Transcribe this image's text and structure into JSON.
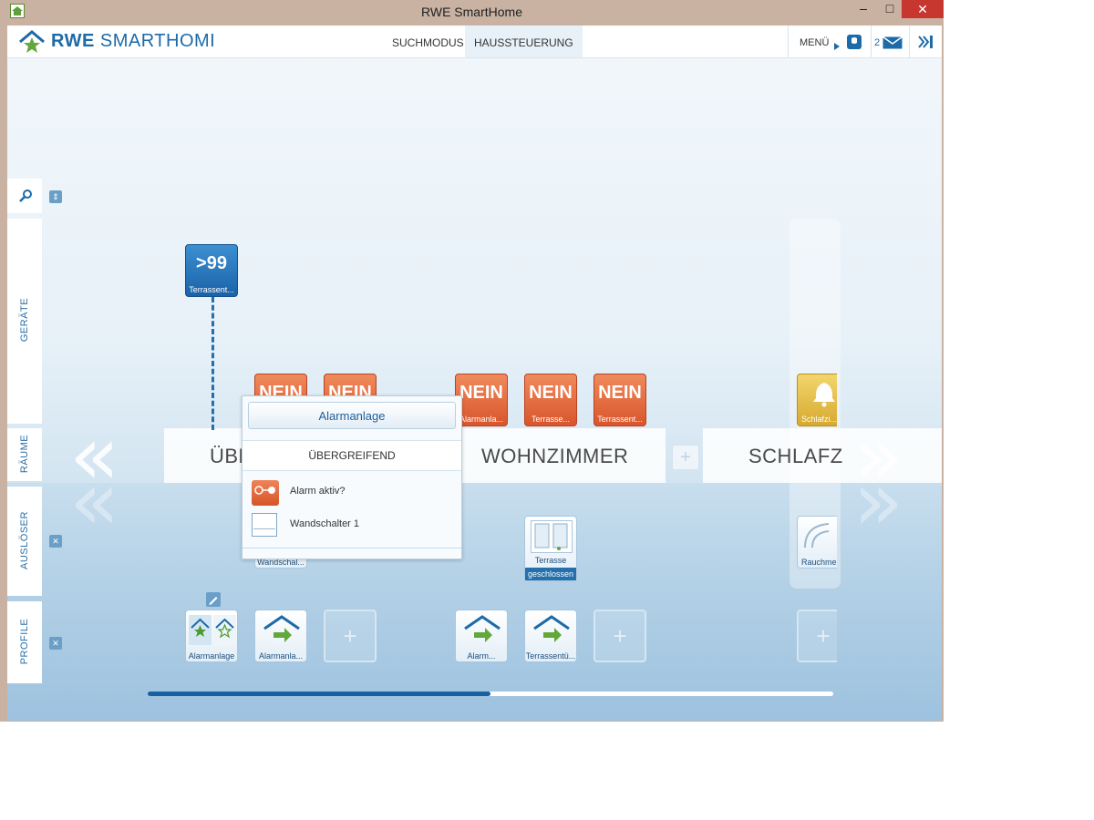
{
  "window": {
    "title": "RWE SmartHome",
    "minimize": "–",
    "maximize": "□",
    "close": "✕"
  },
  "header": {
    "logo_bold": "RWE",
    "logo_rest": "SMARTHOMI",
    "nav": [
      "SUCHMODUS",
      "HAUSSTEUERUNG"
    ],
    "menu_label": "MENÜ",
    "message_count": "2"
  },
  "rail": {
    "labels": [
      "GERÄTE",
      "RÄUME",
      "AUSLÖSER",
      "PROFILE"
    ]
  },
  "rooms": {
    "names": [
      "ÜBE",
      "WOHNZIMMER",
      "SCHLAFZ"
    ]
  },
  "tiles": {
    "top_counter": {
      "value": ">99",
      "label": "Terrassent..."
    },
    "nein": [
      {
        "value": "NEIN",
        "label": ""
      },
      {
        "value": "NEIN",
        "label": ""
      },
      {
        "value": "NEIN",
        "label": "Alarmanla..."
      },
      {
        "value": "NEIN",
        "label": "Terrasse..."
      },
      {
        "value": "NEIN",
        "label": "Terrassent..."
      }
    ],
    "schlafzimmer_label": "Schlafzi...",
    "trigger_wandschalter": "Wandschal...",
    "trigger_terrasse": [
      "Terrasse",
      "geschlossen"
    ],
    "trigger_rauchmelder": "Rauchmel...",
    "profiles": [
      "Alarmanlage",
      "Alarmanla...",
      "Alarm...",
      "Terrassentü..."
    ],
    "add": "+"
  },
  "popup": {
    "title": "Alarmanlage",
    "subtitle": "ÜBERGREIFEND",
    "rows": [
      "Alarm aktiv?",
      "Wandschalter 1"
    ]
  },
  "scrollbar": {
    "progress": 0.5
  },
  "colors": {
    "accent": "#1d6aa8",
    "red_tile": "#e0653a",
    "progress": "#1a5fa0"
  }
}
